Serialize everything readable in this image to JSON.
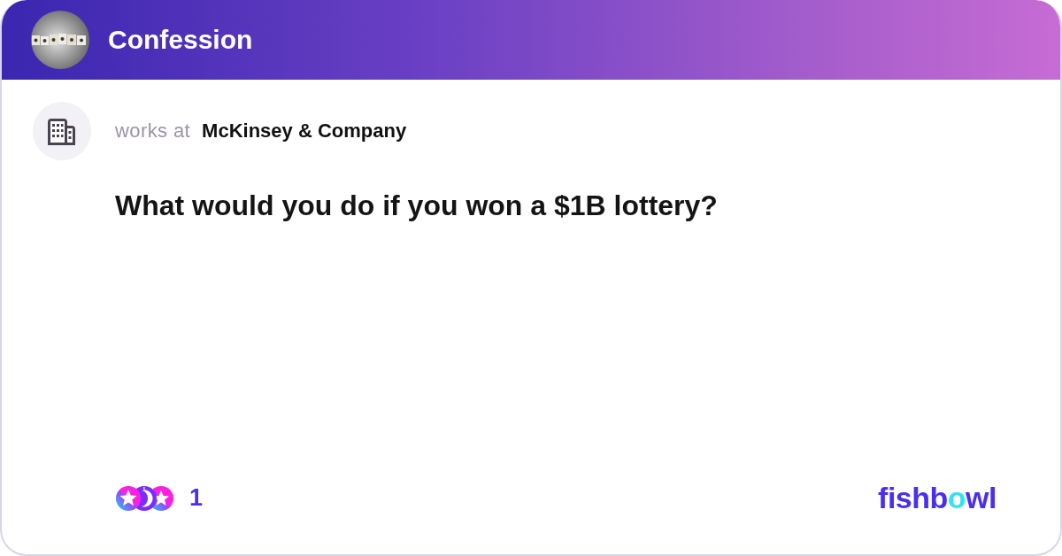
{
  "header": {
    "title": "Confession"
  },
  "post": {
    "author_label": "works at",
    "company": "McKinsey & Company",
    "question": "What would you do if you won a $1B lottery?"
  },
  "footer": {
    "reaction_count": "1",
    "logo": [
      {
        "text": "fishb",
        "color": "#4a2ff0"
      },
      {
        "text": "o",
        "color": "#2fe3f0"
      },
      {
        "text": "wl",
        "color": "#4a2ff0"
      }
    ]
  }
}
